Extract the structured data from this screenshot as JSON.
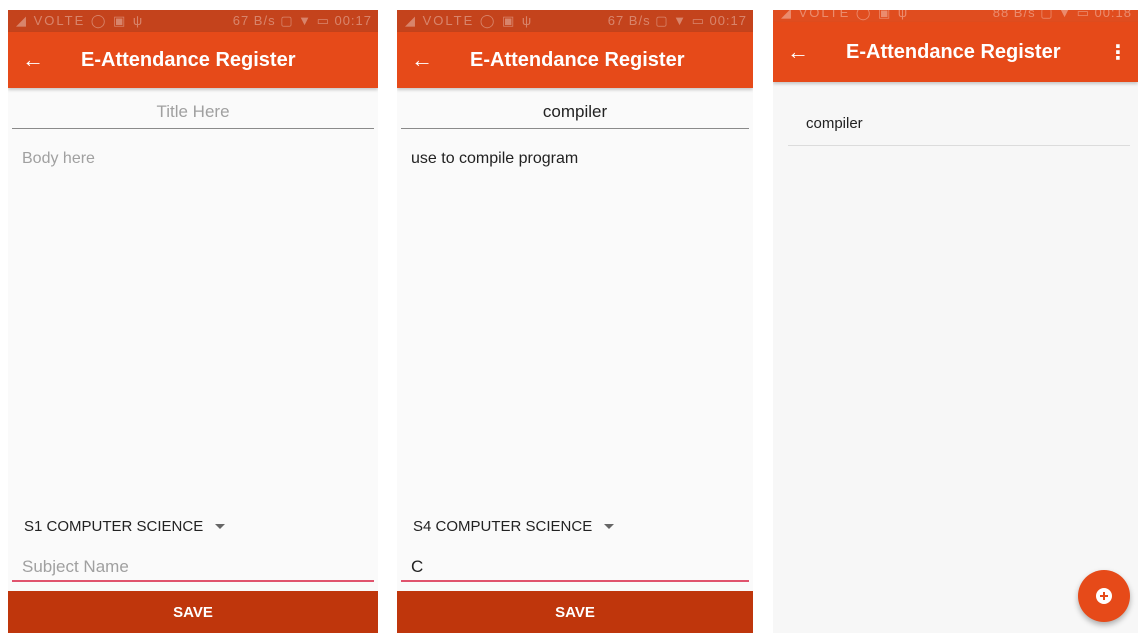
{
  "screens": [
    {
      "status": {
        "left": "◢ VOLTE ◯ ▣ ψ",
        "right": "67 B/s ▢ ▼ ▭ 00:17"
      },
      "appbar": {
        "back_icon": "←",
        "title": "E-Attendance Register"
      },
      "title_field": {
        "value": "",
        "placeholder": "Title Here"
      },
      "body_field": {
        "value": "",
        "placeholder": "Body here"
      },
      "class_select": {
        "selected": "S1 COMPUTER SCIENCE"
      },
      "subject_field": {
        "value": "",
        "placeholder": "Subject Name"
      },
      "save_label": "SAVE"
    },
    {
      "status": {
        "left": "◢ VOLTE ◯ ▣ ψ",
        "right": "67 B/s ▢ ▼ ▭ 00:17"
      },
      "appbar": {
        "back_icon": "←",
        "title": "E-Attendance Register"
      },
      "title_field": {
        "value": "compiler",
        "placeholder": "Title Here"
      },
      "body_field": {
        "value": "use to compile program",
        "placeholder": "Body here"
      },
      "class_select": {
        "selected": "S4 COMPUTER SCIENCE"
      },
      "subject_field": {
        "value": "C",
        "placeholder": "Subject Name"
      },
      "save_label": "SAVE"
    },
    {
      "status": {
        "left": "◢ VOLTE ◯ ▣ ψ",
        "right": "88 B/s ▢ ▼ ▭ 00:18"
      },
      "appbar": {
        "back_icon": "←",
        "title": "E-Attendance Register",
        "menu_icon": "⋮"
      },
      "list": [
        {
          "label": "compiler"
        }
      ],
      "fab_icon": "plus-circle-icon"
    }
  ],
  "colors": {
    "appbar": "#e64a19",
    "statusbar": "#c4431c",
    "save_button": "#bf360c",
    "subject_underline": "#e0536d",
    "fab": "#e64a19"
  }
}
